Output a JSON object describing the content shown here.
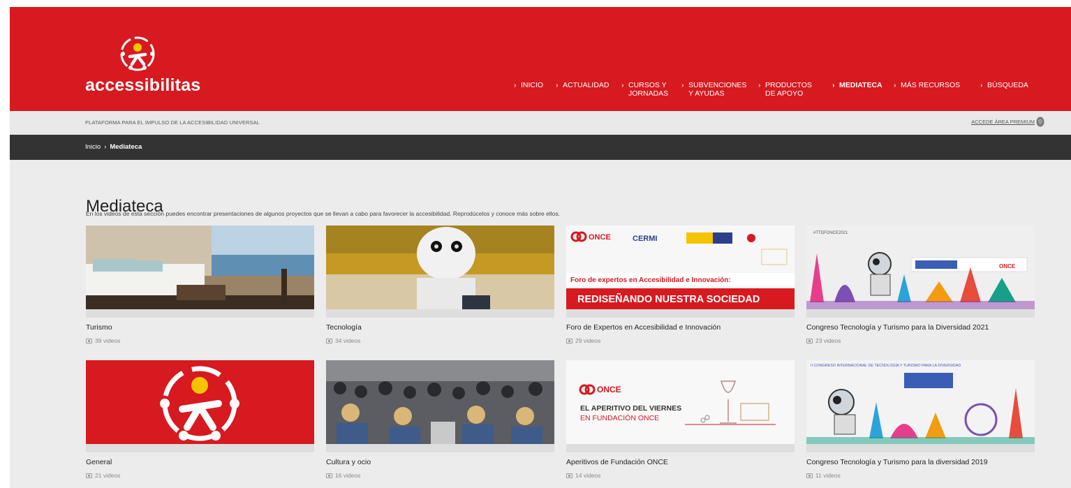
{
  "brand": {
    "name": "accessibilitas",
    "tagline": "PLATAFORMA PARA EL IMPULSO DE LA ACCESIBILIDAD UNIVERSAL",
    "premium_link": "ACCEDE ÁREA PREMIUM",
    "primary_color": "#d71920",
    "dark_bar_color": "#333333"
  },
  "nav": [
    {
      "line1": "INICIO",
      "line2": ""
    },
    {
      "line1": "ACTUALIDAD",
      "line2": ""
    },
    {
      "line1": "CURSOS Y",
      "line2": "JORNADAS"
    },
    {
      "line1": "SUBVENCIONES",
      "line2": "Y AYUDAS"
    },
    {
      "line1": "PRODUCTOS",
      "line2": "DE APOYO"
    },
    {
      "line1": "MEDIATECA",
      "line2": "",
      "active": true
    },
    {
      "line1": "MÁS RECURSOS",
      "line2": ""
    },
    {
      "line1": "BÚSQUEDA",
      "line2": ""
    }
  ],
  "breadcrumb": {
    "home": "Inicio",
    "current": "Mediateca"
  },
  "page": {
    "title": "Mediateca",
    "intro": "En los videos de esta sección puedes encontrar presentaciones de algunos proyectos que se llevan a cabo para favorecer la accesibilidad. Reprodúcelos y conoce más sobre ellos."
  },
  "cards": [
    {
      "title": "Turismo",
      "count": "39 videos"
    },
    {
      "title": "Tecnología",
      "count": "34 videos"
    },
    {
      "title": "Foro de Expertos en Accesibilidad e Innovación",
      "count": "29 videos"
    },
    {
      "title": "Congreso Tecnología y Turismo para la Diversidad 2021",
      "count": "23 videos"
    },
    {
      "title": "General",
      "count": "21 videos"
    },
    {
      "title": "Cultura y ocio",
      "count": "16 videos"
    },
    {
      "title": "Aperitivos de Fundación ONCE",
      "count": "14 videos"
    },
    {
      "title": "Congreso Tecnología y Turismo para la diversidad 2019",
      "count": "11 videos"
    }
  ],
  "thumb_text": {
    "foro_banner_top": "Foro de expertos en Accesibilidad e Innovación:",
    "foro_banner_bottom": "REDISEÑANDO NUESTRA SOCIEDAD",
    "foro_logo": "ONCE",
    "foro_cermi": "CERMI",
    "congreso21_tag": "#TTDFONCE2021",
    "congreso21_logo": "ONCE",
    "aper_logo": "ONCE",
    "aper_line1": "EL APERITIVO DEL VIERNES",
    "aper_line2": "EN FUNDACIÓN ONCE",
    "congreso19_header": "II CONGRESO INTERNACIONAL DE TECNOLOGÍA Y TURISMO PARA LA DIVERSIDAD"
  }
}
